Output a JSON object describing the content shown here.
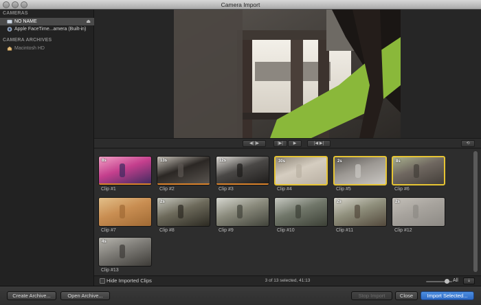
{
  "window": {
    "title": "Camera Import"
  },
  "sidebar": {
    "cameras_heading": "CAMERAS",
    "cameras": [
      {
        "label": "NO NAME",
        "icon": "drive-icon"
      },
      {
        "label": "Apple FaceTime...amera (Built-in)",
        "icon": "facetime-camera-icon"
      }
    ],
    "archives_heading": "CAMERA ARCHIVES",
    "archives": [
      {
        "label": "Macintosh HD",
        "icon": "hard-drive-icon"
      }
    ]
  },
  "clips": [
    {
      "label": "Clip #1",
      "duration": "8s",
      "selected": false,
      "palette": [
        "#3b2a5e",
        "#c43f8d",
        "#f3a1c6"
      ]
    },
    {
      "label": "Clip #2",
      "duration": "13s",
      "selected": false,
      "palette": [
        "#5b5651",
        "#2b2724",
        "#c8c2b9"
      ]
    },
    {
      "label": "Clip #3",
      "duration": "12s",
      "selected": false,
      "palette": [
        "#1d1b1a",
        "#4a4846",
        "#e0ddd8"
      ]
    },
    {
      "label": "Clip #4",
      "duration": "30s",
      "selected": true,
      "palette": [
        "#b9b0a3",
        "#d5cdc0",
        "#8e8679"
      ]
    },
    {
      "label": "Clip #5",
      "duration": "2s",
      "selected": true,
      "palette": [
        "#c9c6c2",
        "#9c9893",
        "#5a5753"
      ]
    },
    {
      "label": "Clip #6",
      "duration": "8s",
      "selected": true,
      "palette": [
        "#433e39",
        "#6f6760",
        "#a8b08d"
      ]
    },
    {
      "label": "Clip #7",
      "duration": "",
      "selected": false,
      "palette": [
        "#a06a34",
        "#c98e52",
        "#e3c08a"
      ]
    },
    {
      "label": "Clip #8",
      "duration": "2s",
      "selected": false,
      "palette": [
        "#2c2a22",
        "#6d6a5b",
        "#c7c8bf"
      ]
    },
    {
      "label": "Clip #9",
      "duration": "",
      "selected": false,
      "palette": [
        "#41433a",
        "#8a8a7c",
        "#d6d7d0"
      ]
    },
    {
      "label": "Clip #10",
      "duration": "",
      "selected": false,
      "palette": [
        "#3c4036",
        "#71776a",
        "#c7c9c2"
      ]
    },
    {
      "label": "Clip #11",
      "duration": "2s",
      "selected": false,
      "palette": [
        "#53493c",
        "#8f8f7c",
        "#d8d6cd"
      ]
    },
    {
      "label": "Clip #12",
      "duration": "2s",
      "selected": false,
      "palette": [
        "#8d8a85",
        "#a7a39d",
        "#c3bfb8"
      ]
    },
    {
      "label": "Clip #13",
      "duration": "4s",
      "selected": false,
      "palette": [
        "#3d3b37",
        "#7d7b76",
        "#b7b5ae"
      ]
    }
  ],
  "browser_bar": {
    "hide_imported_label": "Hide Imported Clips",
    "selection_status": "3 of 13 selected, 41:13",
    "zoom_label": "All"
  },
  "footer": {
    "create_archive": "Create Archive...",
    "open_archive": "Open Archive...",
    "stop_import": "Stop Import",
    "close": "Close",
    "import_selected": "Import Selected..."
  },
  "colors": {
    "selection_border": "#e7c533",
    "primary_button": "#2c69c4",
    "progress_bar": "#d9822b"
  }
}
